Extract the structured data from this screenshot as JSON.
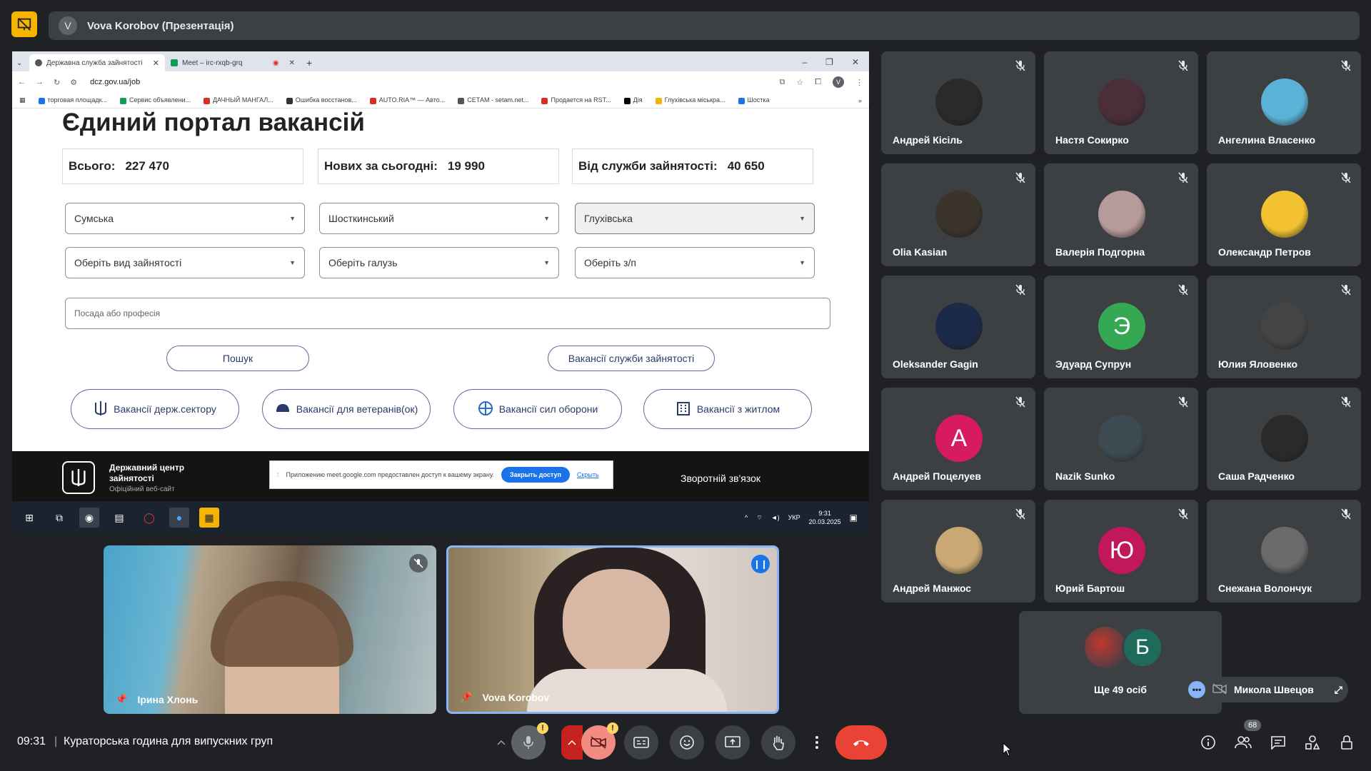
{
  "presenter": {
    "avatar_letter": "V",
    "title": "Vova Korobov (Презентація)"
  },
  "browser": {
    "tabs": [
      {
        "label": "Державна служба зайнятості"
      },
      {
        "label": "Meet – irc-rxqb-grq"
      }
    ],
    "url": "dcz.gov.ua/job",
    "profile_letter": "V",
    "bookmarks": [
      {
        "label": "торговая площадк...",
        "color": "#1a73e8"
      },
      {
        "label": "Сервис объявлени...",
        "color": "#0f9d58"
      },
      {
        "label": "ДАЧНЫЙ МАНГАЛ...",
        "color": "#d93025"
      },
      {
        "label": "Ошибка восстанов...",
        "color": "#333333"
      },
      {
        "label": "AUTO.RIA™ — Авто...",
        "color": "#d93025"
      },
      {
        "label": "СЕТАМ - setam.net...",
        "color": "#555555"
      },
      {
        "label": "Продается на RST...",
        "color": "#d93025"
      },
      {
        "label": "Дія",
        "color": "#000000"
      },
      {
        "label": "Глухівська міськра...",
        "color": "#f4b400"
      },
      {
        "label": "Шостка",
        "color": "#1a73e8"
      }
    ]
  },
  "site": {
    "title": "Єдиний портал вакансій",
    "stats": [
      {
        "label": "Всього:",
        "value": "227 470"
      },
      {
        "label": "Нових за сьогодні:",
        "value": "19 990"
      },
      {
        "label": "Від служби зайнятості:",
        "value": "40 650"
      }
    ],
    "selects_row1": [
      "Сумська",
      "Шосткинський",
      "Глухівська"
    ],
    "selects_row2": [
      "Оберіть вид зайнятості",
      "Оберіть галузь",
      "Оберіть з/п"
    ],
    "position_placeholder": "Посада або професія",
    "search_button": "Пошук",
    "employment_service_button": "Вакансії служби зайнятості",
    "category_buttons": [
      "Вакансії держ.сектору",
      "Вакансії для ветеранів(ок)",
      "Вакансії сил оборони",
      "Вакансії з житлом"
    ],
    "footer": {
      "org_name": "Державний центр зайнятості",
      "org_sub": "Офіційний веб-сайт",
      "feedback": "Зворотній зв'язок"
    },
    "share_notice": {
      "text": "Приложению meet.google.com предоставлен доступ к вашему экрану.",
      "stop_button": "Закрыть доступ",
      "hide_link": "Скрыть"
    }
  },
  "taskbar": {
    "lang": "УКР",
    "time": "9:31",
    "date": "20.03.2025"
  },
  "participants": [
    {
      "name": "Андрей Кісіль",
      "avatar": "photo",
      "color": "#2a2a2a"
    },
    {
      "name": "Настя Сокирко",
      "avatar": "photo",
      "color": "#4a2f3a"
    },
    {
      "name": "Ангелина Власенко",
      "avatar": "photo",
      "color": "#5ab3d6"
    },
    {
      "name": "Olia Kasian",
      "avatar": "photo",
      "color": "#3b342c"
    },
    {
      "name": "Валерія Подгорна",
      "avatar": "photo",
      "color": "#b79a9a"
    },
    {
      "name": "Олександр Петров",
      "avatar": "photo",
      "color": "#f2c230"
    },
    {
      "name": "Oleksander Gagin",
      "avatar": "photo",
      "color": "#1c2a4a"
    },
    {
      "name": "Эдуард Супрун",
      "avatar": "Э",
      "color": "#34a853"
    },
    {
      "name": "Юлия Яловенко",
      "avatar": "photo",
      "color": "#444444"
    },
    {
      "name": "Андрей Поцелуев",
      "avatar": "А",
      "color": "#d81b60"
    },
    {
      "name": "Nazik Sunko",
      "avatar": "photo",
      "color": "#3d4a52"
    },
    {
      "name": "Саша Радченко",
      "avatar": "photo",
      "color": "#2a2a2a"
    },
    {
      "name": "Андрей Манжос",
      "avatar": "photo",
      "color": "#c9a873"
    },
    {
      "name": "Юрий Бартош",
      "avatar": "Ю",
      "color": "#c2185b"
    },
    {
      "name": "Снежана Волончук",
      "avatar": "photo",
      "color": "#6b6b6b"
    }
  ],
  "more": {
    "second_avatar_letter": "Б",
    "label": "Ще 49 осіб"
  },
  "mini_self": {
    "name": "Микола Швецов"
  },
  "videos": [
    {
      "name": "Ірина Хлонь"
    },
    {
      "name": "Vova Korobov"
    }
  ],
  "meeting": {
    "time": "09:31",
    "separator": "|",
    "title": "Кураторська година для випускних груп",
    "people_count": "68"
  },
  "colors": {
    "background": "#202124",
    "tile": "#3c4043",
    "hangup": "#ea4335",
    "accent": "#8ab4f8",
    "presentation_icon": "#f5b400"
  }
}
